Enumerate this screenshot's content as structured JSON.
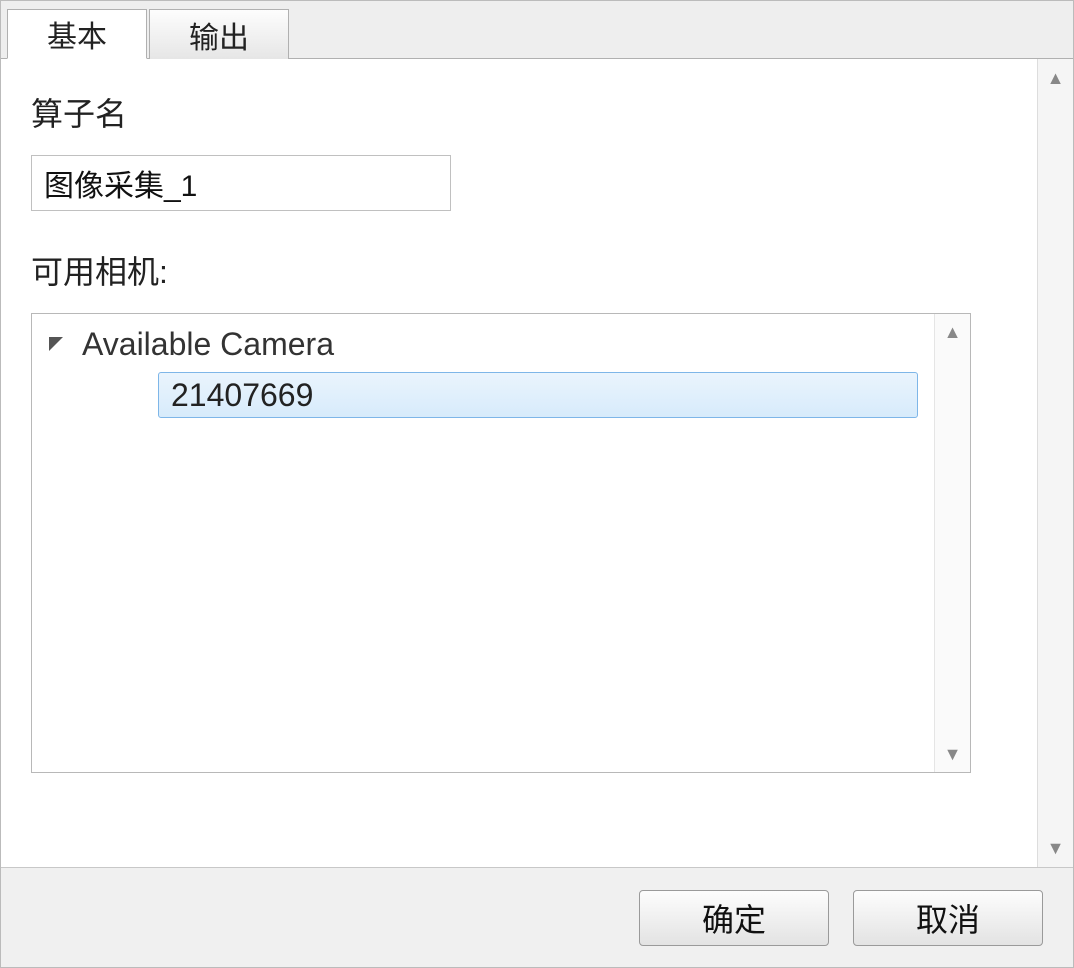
{
  "tabs": {
    "basic": "基本",
    "output": "输出"
  },
  "form": {
    "operator_name_label": "算子名",
    "operator_name_value": "图像采集_1",
    "available_camera_label": "可用相机:"
  },
  "tree": {
    "root_label": "Available Camera",
    "selected_item": "21407669"
  },
  "buttons": {
    "ok": "确定",
    "cancel": "取消"
  }
}
